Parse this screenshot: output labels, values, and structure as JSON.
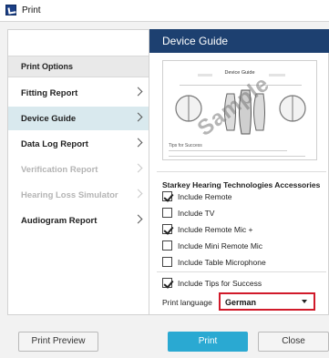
{
  "window": {
    "title": "Print"
  },
  "sidebar": {
    "header": "Print Options",
    "items": [
      {
        "label": "Fitting Report",
        "state": "normal"
      },
      {
        "label": "Device Guide",
        "state": "selected"
      },
      {
        "label": "Data Log Report",
        "state": "normal"
      },
      {
        "label": "Verification Report",
        "state": "disabled"
      },
      {
        "label": "Hearing Loss Simulator",
        "state": "disabled"
      },
      {
        "label": "Audiogram Report",
        "state": "normal"
      }
    ]
  },
  "main": {
    "title": "Device Guide",
    "preview": {
      "doc_title": "Device Guide",
      "tips_heading": "Tips for Success",
      "watermark": "Sample"
    },
    "accessories": {
      "title": "Starkey Hearing Technologies Accessories",
      "options": [
        {
          "label": "Include Remote",
          "checked": true
        },
        {
          "label": "Include TV",
          "checked": false
        },
        {
          "label": "Include Remote Mic +",
          "checked": true
        },
        {
          "label": "Include Mini Remote Mic",
          "checked": false
        },
        {
          "label": "Include Table Microphone",
          "checked": false
        }
      ]
    },
    "tips": {
      "label": "Include Tips for Success",
      "checked": true
    },
    "language": {
      "label": "Print language",
      "value": "German",
      "highlight_color": "#d11a2a"
    }
  },
  "buttons": {
    "print_preview": "Print Preview",
    "print": "Print",
    "close": "Close"
  },
  "colors": {
    "header_bg": "#1d4070",
    "selected_bg": "#d9e9ee",
    "primary_button": "#2aa9d2"
  }
}
